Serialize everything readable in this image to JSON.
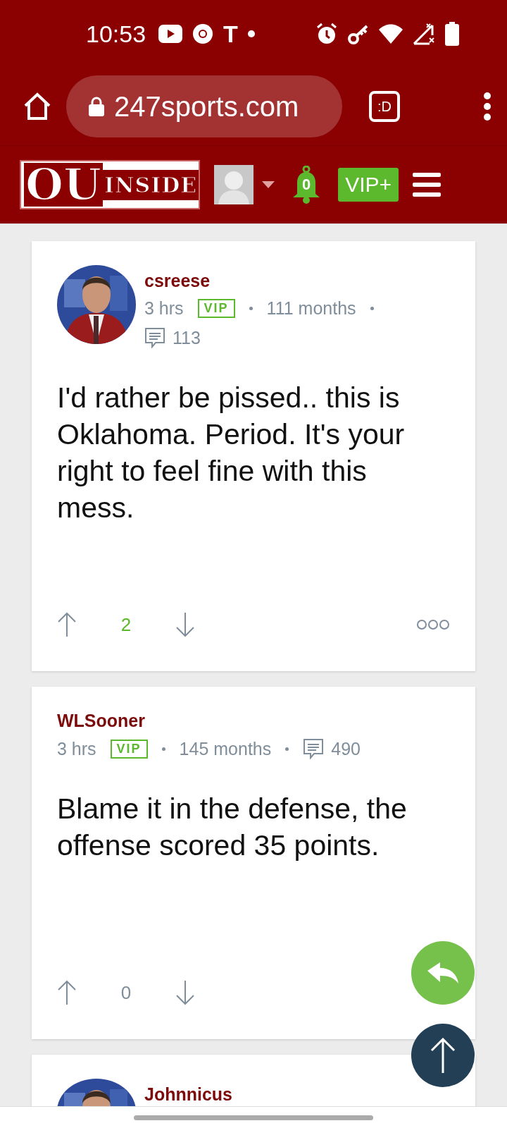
{
  "status_bar": {
    "time": "10:53",
    "app_letter": "T"
  },
  "browser": {
    "url": "247sports.com",
    "tab_switcher": ":D"
  },
  "site_header": {
    "logo_big": "OU",
    "logo_small": "INSIDE",
    "notifications": "0",
    "vip_button": "VIP+"
  },
  "comments": [
    {
      "author": "csreese",
      "has_avatar": true,
      "time": "3 hrs",
      "badge": "VIP",
      "tenure": "111 months",
      "comment_count": "113",
      "body": "I'd rather be pissed.. this is Oklahoma. Period. It's your right to feel fine with this mess.",
      "score": "2",
      "score_positive": true,
      "more_visible": true
    },
    {
      "author": "WLSooner",
      "has_avatar": false,
      "time": "3 hrs",
      "badge": "VIP",
      "tenure": "145 months",
      "comment_count": "490",
      "body": "Blame it in the defense, the offense scored 35 points.",
      "score": "0",
      "score_positive": false,
      "more_visible": false
    },
    {
      "author": "Johnnicus",
      "has_avatar": true
    }
  ]
}
